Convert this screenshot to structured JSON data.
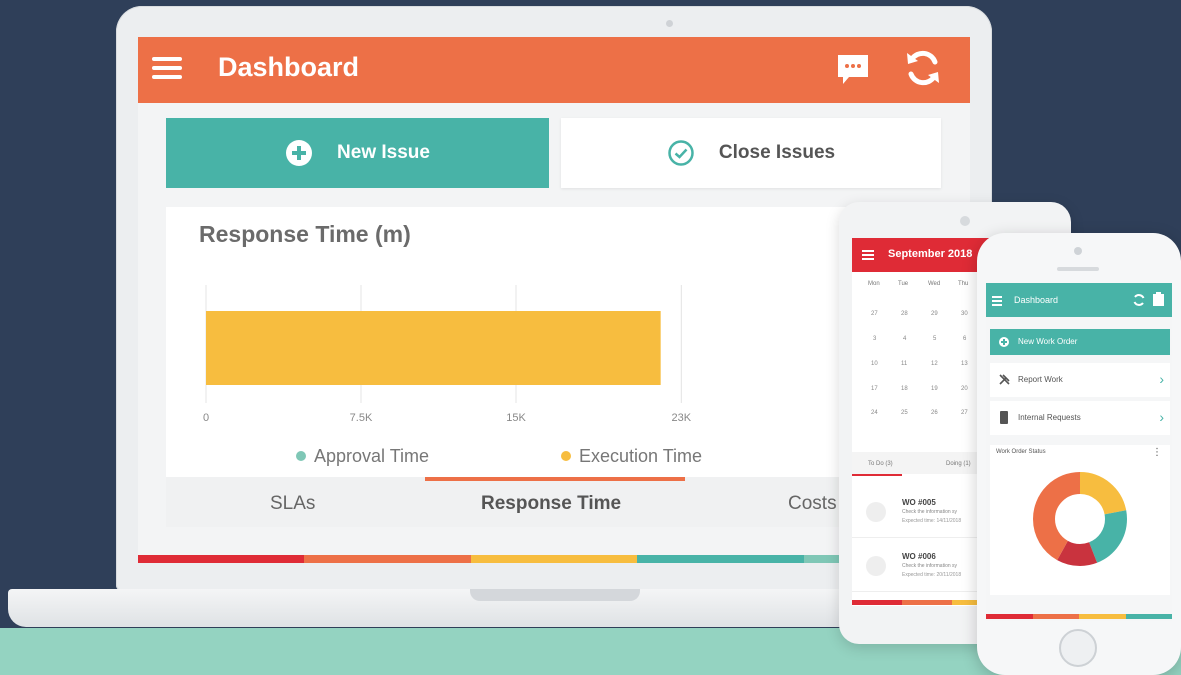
{
  "laptop": {
    "app_title": "Dashboard",
    "icons": {
      "menu": "hamburger-menu-icon",
      "chat": "chat-bubble-icon",
      "sync": "sync-icon"
    },
    "new_issue_label": "New Issue",
    "close_issues_label": "Close Issues",
    "chart_card": {
      "title": "Response Time (m)"
    },
    "tabs": [
      {
        "label": "SLAs",
        "active": false
      },
      {
        "label": "Response Time",
        "active": true
      },
      {
        "label": "Costs",
        "active": false
      }
    ]
  },
  "chart_data": {
    "type": "bar",
    "orientation": "horizontal",
    "title": "Response Time (m)",
    "xlim": [
      0,
      30000
    ],
    "x_ticks": [
      "0",
      "7.5K",
      "15K",
      "23K"
    ],
    "x_tick_values": [
      0,
      7500,
      15000,
      23000
    ],
    "series": [
      {
        "name": "Approval Time",
        "color": "#7fc7b6",
        "values": [
          0
        ]
      },
      {
        "name": "Execution Time",
        "color": "#f7bd3f",
        "values": [
          22000
        ]
      }
    ],
    "legend_position": "bottom-center",
    "grid": true
  },
  "tablet": {
    "calendar_title": "September 2018",
    "weekdays": [
      "Mon",
      "Tue",
      "Wed",
      "Thu"
    ],
    "weeks": [
      [
        "27",
        "28",
        "29",
        "30"
      ],
      [
        "3",
        "4",
        "5",
        "6"
      ],
      [
        "10",
        "11",
        "12",
        "13"
      ],
      [
        "17",
        "18",
        "19",
        "20"
      ],
      [
        "24",
        "25",
        "26",
        "27"
      ]
    ],
    "tabs": [
      "To Do (3)",
      "Doing (1)"
    ],
    "work_orders": [
      {
        "id": "WO #005",
        "desc": "Check the information sy",
        "expected": "Expected time: 14/11/2018"
      },
      {
        "id": "WO #006",
        "desc": "Check the information sy",
        "expected": "Expected time: 20/11/2018"
      }
    ]
  },
  "phone": {
    "title": "Dashboard",
    "new_work_order": "New Work Order",
    "menu_items": [
      "Report Work",
      "Internal Requests"
    ],
    "card_title": "Work Order Status",
    "donut": [
      {
        "value": 0.22,
        "color": "#f7bd3f"
      },
      {
        "value": 0.22,
        "color": "#48b3a7"
      },
      {
        "value": 0.14,
        "color": "#c9333e"
      },
      {
        "value": 0.42,
        "color": "#ed7047"
      }
    ]
  },
  "colors": {
    "brand_orange": "#ed7047",
    "brand_teal": "#48b3a7",
    "brand_red": "#df2b36",
    "brand_yellow": "#f7bd3f",
    "background": "#2f3f59",
    "floor": "#94d3c1"
  }
}
